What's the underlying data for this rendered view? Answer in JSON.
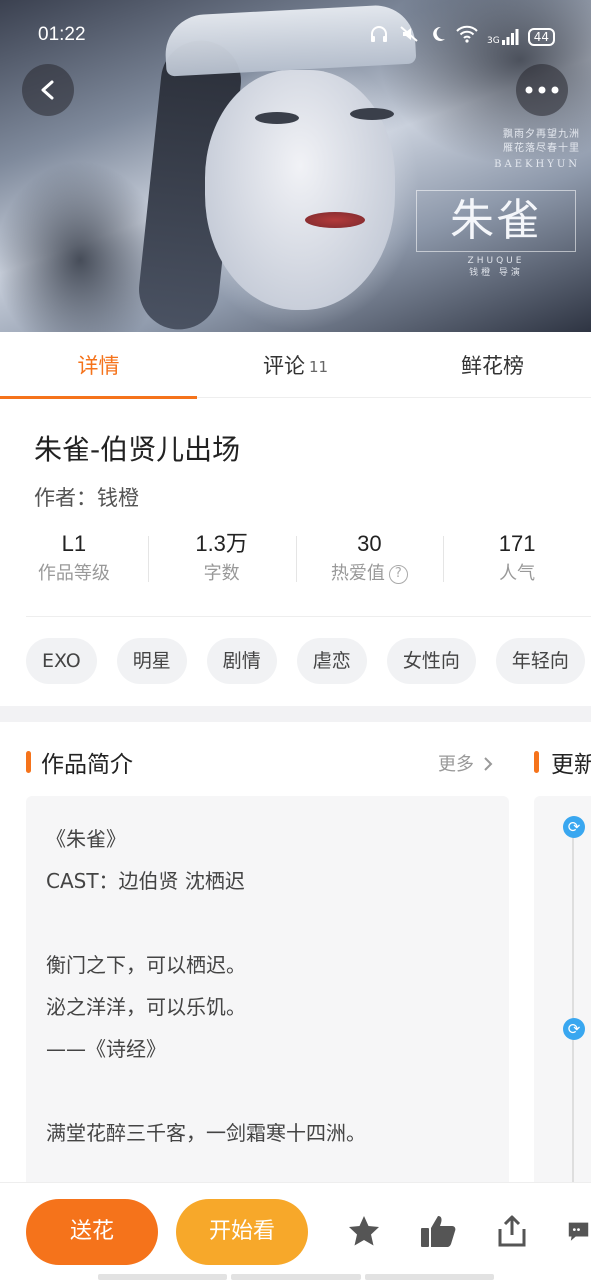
{
  "status_bar": {
    "time": "01:22",
    "network": "3G",
    "battery": "44"
  },
  "cover": {
    "poster_text_line1": "飘雨夕再望九洲",
    "poster_text_line2": "雁花落尽春十里",
    "poster_name": "BAEKHYUN",
    "poster_title": "朱雀",
    "poster_pinyin": "ZHUQUE",
    "poster_credits": "钱橙 导演"
  },
  "tabs": [
    {
      "label": "详情",
      "count": "",
      "active": true
    },
    {
      "label": "评论",
      "count": "11",
      "active": false
    },
    {
      "label": "鲜花榜",
      "count": "",
      "active": false
    }
  ],
  "book": {
    "title": "朱雀-伯贤儿出场",
    "author": "作者：钱橙"
  },
  "stats": [
    {
      "value": "L1",
      "label": "作品等级"
    },
    {
      "value": "1.3万",
      "label": "字数"
    },
    {
      "value": "30",
      "label": "热爱值"
    },
    {
      "value": "171",
      "label": "人气"
    }
  ],
  "tags": [
    "EXO",
    "明星",
    "剧情",
    "虐恋",
    "女性向",
    "年轻向"
  ],
  "intro": {
    "section_title": "作品简介",
    "more_label": "更多",
    "lines": [
      "《朱雀》",
      "CAST：边伯贤 沈栖迟",
      "",
      "衡门之下，可以栖迟。",
      "泌之洋洋，可以乐饥。",
      "——《诗经》",
      "",
      "满堂花醉三千客，一剑霜寒十四洲。"
    ]
  },
  "updates": {
    "section_title": "更新"
  },
  "bottom_bar": {
    "flower_label": "送花",
    "start_label": "开始看"
  },
  "colors": {
    "accent": "#f5731b",
    "start_button": "#f7a82a",
    "sync": "#39a7f0"
  }
}
